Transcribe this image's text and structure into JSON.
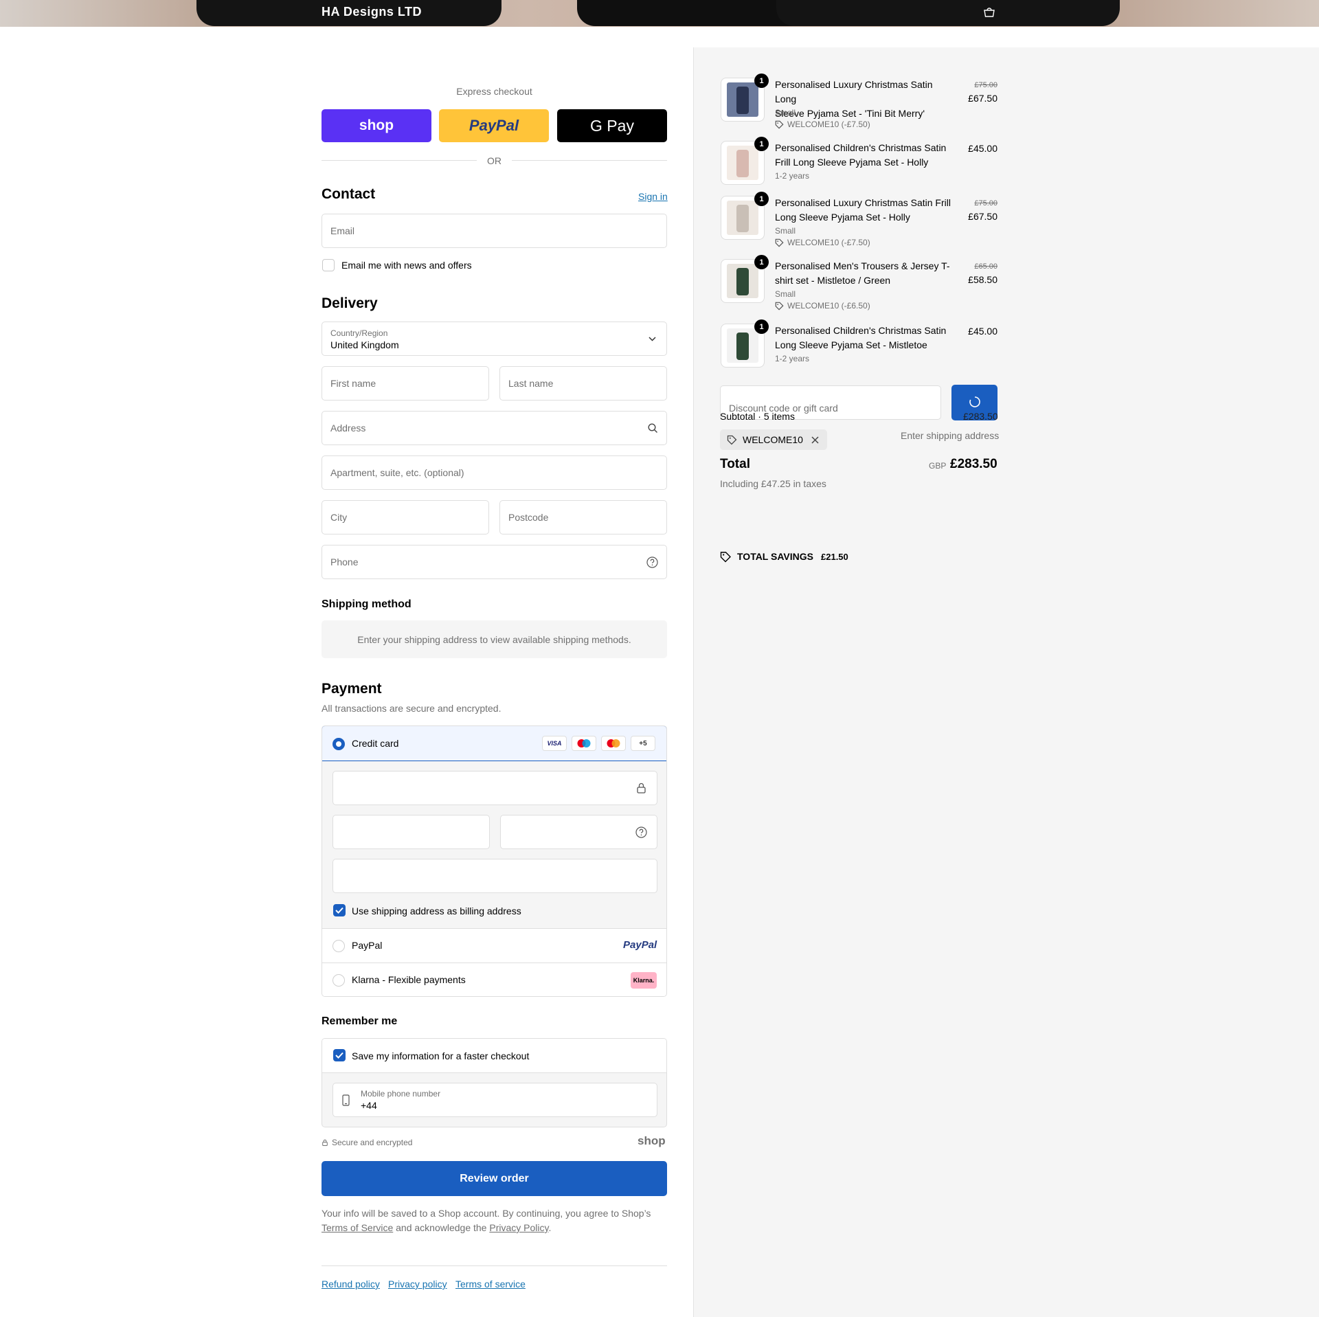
{
  "store": {
    "name": "HA Designs LTD",
    "cart_icon": "bag-icon"
  },
  "express": {
    "label": "Express checkout",
    "shop_label": "shop",
    "paypal_label": "PayPal",
    "gpay_label": "G Pay",
    "or_label": "OR"
  },
  "contact": {
    "title": "Contact",
    "sign_in": "Sign in",
    "email_placeholder": "Email",
    "newsletter_label": "Email me with news and offers"
  },
  "delivery": {
    "title": "Delivery",
    "country_label": "Country/Region",
    "country_value": "United Kingdom",
    "first_name": "First name",
    "last_name": "Last name",
    "address": "Address",
    "apartment": "Apartment, suite, etc. (optional)",
    "city": "City",
    "postcode": "Postcode",
    "phone": "Phone"
  },
  "shipping": {
    "title": "Shipping method",
    "notice": "Enter your shipping address to view available shipping methods."
  },
  "payment": {
    "title": "Payment",
    "subtitle": "All transactions are secure and encrypted.",
    "credit_card": "Credit card",
    "card_logos": [
      "VISA",
      "Maestro",
      "Mastercard",
      "+5"
    ],
    "more_cards": "+5",
    "billing_same": "Use shipping address as billing address",
    "paypal": "PayPal",
    "paypal_logo": "PayPal",
    "klarna": "Klarna - Flexible payments",
    "klarna_logo": "Klarna."
  },
  "remember": {
    "title": "Remember me",
    "save_label": "Save my information for a faster checkout",
    "mobile_label": "Mobile phone number",
    "mobile_value": "+44",
    "secure": "Secure and encrypted",
    "shop_logo": "shop"
  },
  "review_button": "Review order",
  "legal": {
    "text_1": "Your info will be saved to a Shop account. By continuing, you agree to Shop’s",
    "terms": "Terms of Service",
    "text_2": "and acknowledge the",
    "privacy": "Privacy Policy",
    "text_3": "."
  },
  "footer_links": [
    "Refund policy",
    "Privacy policy",
    "Terms of service"
  ],
  "items": [
    {
      "name_1": "Personalised Luxury Christmas Satin Long",
      "name_2": "Sleeve Pyjama Set - 'Tini Bit Merry'",
      "variant": "Small",
      "discount": "WELCOME10 (-£7.50)",
      "old_price": "£75.00",
      "price": "£67.50",
      "qty": "1"
    },
    {
      "name_1": "Personalised Children's Christmas Satin",
      "name_2": "Frill Long Sleeve Pyjama Set - Holly",
      "variant": "1-2 years",
      "discount": "",
      "old_price": "",
      "price": "£45.00",
      "qty": "1"
    },
    {
      "name_1": "Personalised Luxury Christmas Satin Frill",
      "name_2": "Long Sleeve Pyjama Set - Holly",
      "variant": "Small",
      "discount": "WELCOME10 (-£7.50)",
      "old_price": "£75.00",
      "price": "£67.50",
      "qty": "1"
    },
    {
      "name_1": "Personalised Men's Trousers & Jersey T-",
      "name_2": "shirt set - Mistletoe / Green",
      "variant": "Small",
      "discount": "WELCOME10 (-£6.50)",
      "old_price": "£65.00",
      "price": "£58.50",
      "qty": "1"
    },
    {
      "name_1": "Personalised Children's Christmas Satin",
      "name_2": "Long Sleeve Pyjama Set - Mistletoe",
      "variant": "1-2 years",
      "discount": "",
      "old_price": "",
      "price": "£45.00",
      "qty": "1"
    }
  ],
  "summary": {
    "discount_placeholder": "Discount code or gift card",
    "subtotal_label": "Subtotal · 5 items",
    "subtotal_value": "£283.50",
    "code_tag": "WELCOME10",
    "shipping_value": "Enter shipping address",
    "total_label": "Total",
    "currency": "GBP",
    "total_value": "£283.50",
    "taxes": "Including £47.25 in taxes",
    "savings_label": "TOTAL SAVINGS",
    "savings_value": "£21.50"
  },
  "colors": {
    "accent": "#1a5ec0",
    "shop": "#5a31f4",
    "paypal": "#ffc439"
  }
}
